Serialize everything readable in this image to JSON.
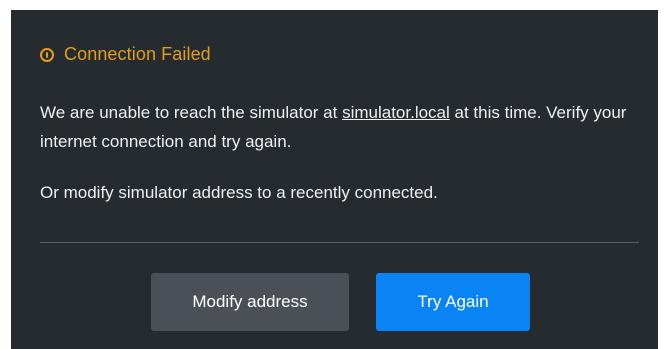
{
  "dialog": {
    "icon": "exclamation-circle-icon",
    "title": "Connection Failed",
    "message": {
      "before_link": "We are unable to reach the simulator at ",
      "link": "simulator.local",
      "after_link": " at this time. Verify your internet connection and try again.",
      "secondary": "Or modify simulator address to a recently connected."
    },
    "buttons": {
      "modify_label": "Modify address",
      "retry_label": "Try Again"
    }
  },
  "colors": {
    "background": "#262b30",
    "warning": "#e39e16",
    "text": "#eef0f2",
    "divider": "#5b6066",
    "secondary_button": "#4a5056",
    "primary_button": "#0a84f4"
  }
}
